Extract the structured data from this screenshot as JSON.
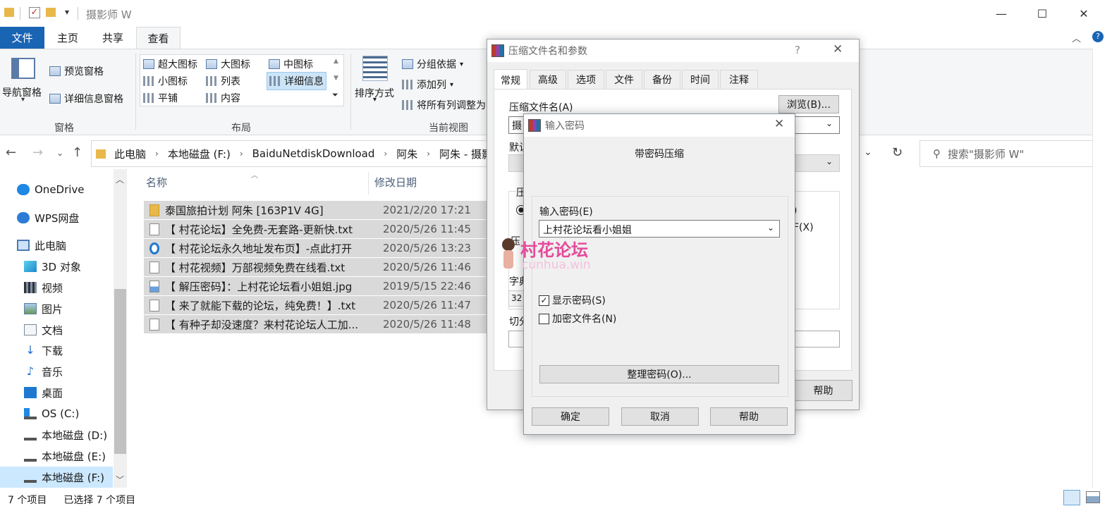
{
  "window": {
    "title": "摄影师 W",
    "minimize": "—",
    "maximize": "☐",
    "close": "✕"
  },
  "ribbon_tabs": [
    "文件",
    "主页",
    "共享",
    "查看"
  ],
  "ribbon": {
    "nav_pane": "导航窗格",
    "preview_pane": "预览窗格",
    "details_pane": "详细信息窗格",
    "group_panes": "窗格",
    "layout": {
      "extra_large": "超大图标",
      "large": "大图标",
      "medium": "中图标",
      "small": "小图标",
      "list": "列表",
      "details": "详细信息",
      "tiles": "平铺",
      "content": "内容"
    },
    "group_layout": "布局",
    "sort_by": "排序方式",
    "group_by": "分组依据",
    "add_column": "添加列",
    "fit_columns": "将所有列调整为",
    "group_current_view": "当前视图"
  },
  "address": {
    "crumbs": [
      "此电脑",
      "本地磁盘 (F:)",
      "BaiduNetdiskDownload",
      "阿朱",
      "阿朱 - 摄影师"
    ],
    "search_placeholder": "搜索\"摄影师 W\""
  },
  "nav_items": [
    {
      "label": "OneDrive",
      "icon": "cloud-icon"
    },
    {
      "label": "WPS网盘",
      "icon": "cloud-icon"
    },
    {
      "label": "此电脑",
      "icon": "computer-icon"
    },
    {
      "label": "3D 对象",
      "icon": "cube-icon"
    },
    {
      "label": "视频",
      "icon": "video-icon"
    },
    {
      "label": "图片",
      "icon": "picture-icon"
    },
    {
      "label": "文档",
      "icon": "document-icon"
    },
    {
      "label": "下载",
      "icon": "download-icon"
    },
    {
      "label": "音乐",
      "icon": "music-icon"
    },
    {
      "label": "桌面",
      "icon": "desktop-icon"
    },
    {
      "label": "OS (C:)",
      "icon": "drive-icon"
    },
    {
      "label": "本地磁盘 (D:)",
      "icon": "drive-icon"
    },
    {
      "label": "本地磁盘 (E:)",
      "icon": "drive-icon"
    },
    {
      "label": "本地磁盘 (F:)",
      "icon": "drive-icon"
    }
  ],
  "columns": {
    "name": "名称",
    "modified": "修改日期"
  },
  "files": [
    {
      "name": "泰国旅拍计划 阿朱 [163P1V 4G]",
      "date": "2021/2/20 17:21",
      "icon": "folder-icon"
    },
    {
      "name": "【 村花论坛】全免费-无套路-更新快.txt",
      "date": "2020/5/26 11:45",
      "icon": "text-file-icon"
    },
    {
      "name": "【 村花论坛永久地址发布页】-点此打开",
      "date": "2020/5/26 13:23",
      "icon": "shortcut-icon"
    },
    {
      "name": "【 村花视频】万部视频免费在线看.txt",
      "date": "2020/5/26 11:46",
      "icon": "text-file-icon"
    },
    {
      "name": "【 解压密码】：上村花论坛看小姐姐.jpg",
      "date": "2019/5/15 22:46",
      "icon": "image-file-icon"
    },
    {
      "name": "【 来了就能下载的论坛，纯免费！】.txt",
      "date": "2020/5/26 11:47",
      "icon": "text-file-icon"
    },
    {
      "name": "【 有种子却没速度？来村花论坛人工加...",
      "date": "2020/5/26 11:48",
      "icon": "text-file-icon"
    }
  ],
  "status": {
    "count": "7 个项目",
    "selected": "已选择 7 个项目"
  },
  "archive_dialog": {
    "title": "压缩文件名和参数",
    "help_q": "?",
    "tabs": [
      "常规",
      "高级",
      "选项",
      "文件",
      "备份",
      "时间",
      "注释"
    ],
    "archive_name_label": "压缩文件名(A)",
    "archive_name_value": "摄",
    "browse": "浏览(B)...",
    "default_label": "默认",
    "compress_label": "压",
    "format_label": "压",
    "dict_label": "字典",
    "dict_value": "32",
    "split_label": "切分",
    "partial_right1": ")",
    "partial_right2": "F(X)",
    "help": "帮助"
  },
  "password_dialog": {
    "title": "输入密码",
    "heading": "带密码压缩",
    "enter_label": "输入密码(E)",
    "password_value": "上村花论坛看小姐姐",
    "show_password": "显示密码(S)",
    "encrypt_names": "加密文件名(N)",
    "organize": "整理密码(O)...",
    "ok": "确定",
    "cancel": "取消",
    "help": "帮助"
  },
  "watermark": {
    "title": "村花论坛",
    "url": "cunhua.win"
  }
}
